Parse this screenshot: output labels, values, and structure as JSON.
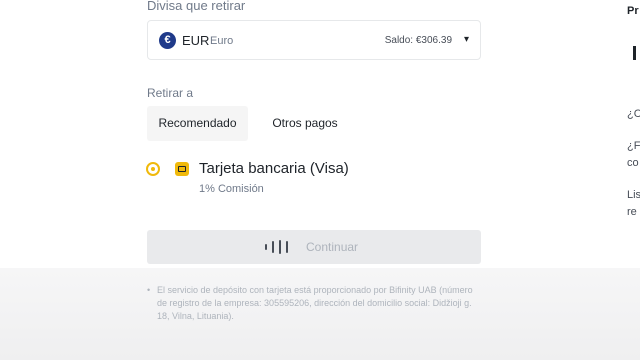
{
  "withdraw_form": {
    "currency_label": "Divisa que retirar",
    "currency": {
      "icon": "euro-icon",
      "icon_glyph": "€",
      "code": "EUR",
      "name": "Euro",
      "balance": "Saldo: €306.39",
      "dropdown_glyph": "▾"
    },
    "withdraw_to_label": "Retirar a",
    "tabs": [
      {
        "label": "Recomendado",
        "active": true
      },
      {
        "label": "Otros pagos",
        "active": false
      }
    ],
    "method": {
      "title": "Tarjeta bancaria (Visa)",
      "fee": "1% Comisión",
      "selected": true
    },
    "continue_button": {
      "label": "Continuar",
      "state": "loading"
    },
    "disclaimer": {
      "bullet": "•",
      "text": "El servicio de depósito con tarjeta está proporcionado por Bifinity UAB (número de registro de la empresa: 305595206, dirección del domicilio social: Didžioji g. 18, Vilna, Lituania)."
    }
  },
  "side_panel": {
    "title": "Pr",
    "lines": [
      "¿C",
      "¿F",
      "co",
      "Lis",
      "re"
    ]
  },
  "colors": {
    "accent": "#f0b90b",
    "text_primary": "#1e2329",
    "text_secondary": "#707a8a",
    "disabled_button": "#e9eaec"
  }
}
